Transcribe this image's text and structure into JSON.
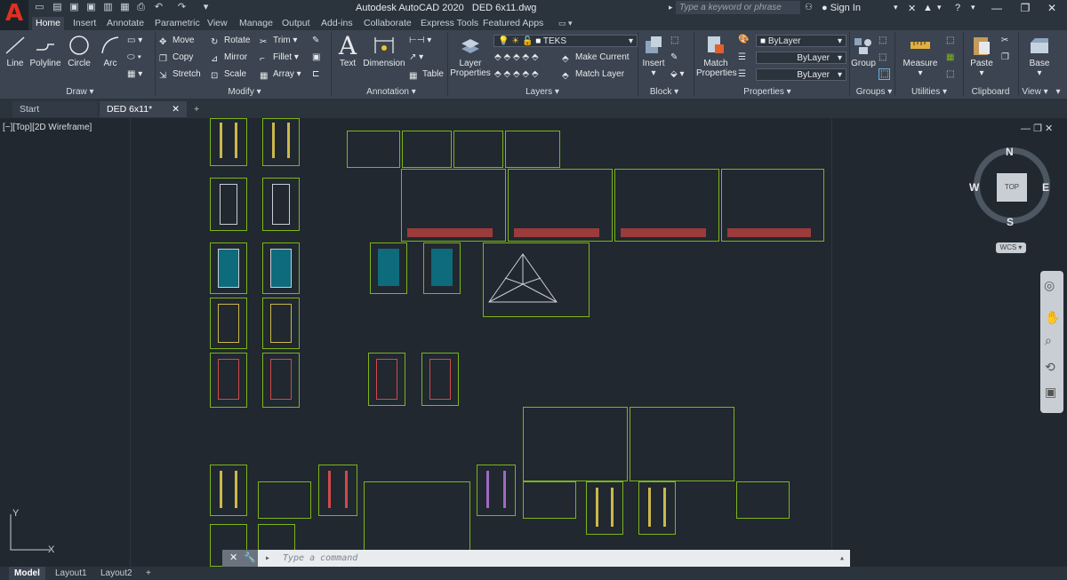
{
  "app": {
    "title": "Autodesk AutoCAD 2020",
    "filename": "DED 6x11.dwg",
    "logo": "A"
  },
  "search": {
    "placeholder": "Type a keyword or phrase"
  },
  "signin": {
    "label": "Sign In"
  },
  "ribbon_tabs": [
    "Home",
    "Insert",
    "Annotate",
    "Parametric",
    "View",
    "Manage",
    "Output",
    "Add-ins",
    "Collaborate",
    "Express Tools",
    "Featured Apps"
  ],
  "draw": {
    "line": "Line",
    "polyline": "Polyline",
    "circle": "Circle",
    "arc": "Arc",
    "panel": "Draw"
  },
  "modify": {
    "move": "Move",
    "rotate": "Rotate",
    "trim": "Trim",
    "copy": "Copy",
    "mirror": "Mirror",
    "fillet": "Fillet",
    "stretch": "Stretch",
    "scale": "Scale",
    "array": "Array",
    "panel": "Modify"
  },
  "annotation": {
    "text": "Text",
    "dimension": "Dimension",
    "table": "Table",
    "panel": "Annotation"
  },
  "layers": {
    "layer_properties": "Layer Properties",
    "current_layer": "TEKS",
    "make_current": "Make Current",
    "match_layer": "Match Layer",
    "panel": "Layers"
  },
  "block": {
    "insert": "Insert",
    "panel": "Block"
  },
  "properties": {
    "match_properties": "Match Properties",
    "color": "ByLayer",
    "linetype": "ByLayer",
    "lineweight": "ByLayer",
    "panel": "Properties"
  },
  "groups": {
    "group": "Group",
    "panel": "Groups"
  },
  "utilities": {
    "measure": "Measure",
    "panel": "Utilities"
  },
  "clipboard": {
    "paste": "Paste",
    "panel": "Clipboard"
  },
  "view": {
    "base": "Base",
    "panel": "View"
  },
  "file_tabs": {
    "start": "Start",
    "drawing": "DED 6x11*"
  },
  "viewport": {
    "label": "[−][Top][2D Wireframe]"
  },
  "viewcube": {
    "n": "N",
    "s": "S",
    "e": "E",
    "w": "W",
    "face": "TOP",
    "wcs": "WCS"
  },
  "ucs": {
    "x": "X",
    "y": "Y"
  },
  "command": {
    "placeholder": "Type a command"
  },
  "status_tabs": [
    "Model",
    "Layout1",
    "Layout2"
  ],
  "colors": {
    "accent_green": "#7cb518",
    "background": "#212830",
    "ribbon": "#3b4450"
  }
}
